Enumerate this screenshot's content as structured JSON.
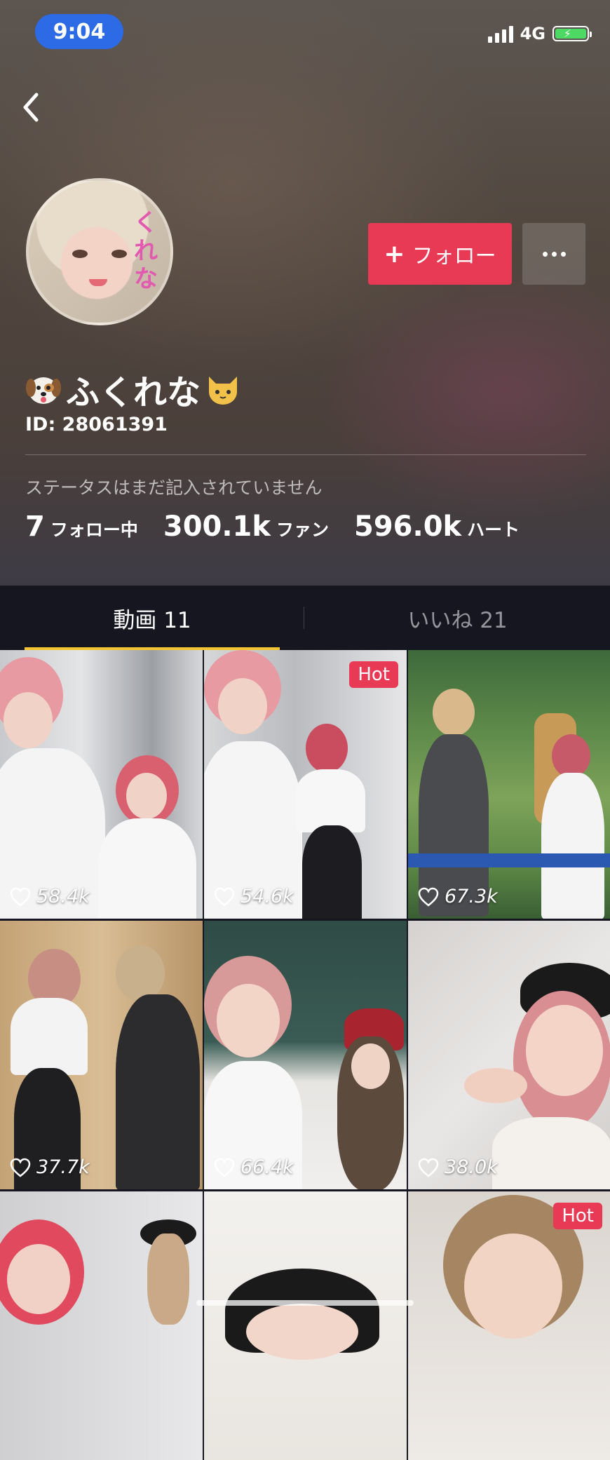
{
  "status_bar": {
    "time": "9:04",
    "network": "4G"
  },
  "profile": {
    "name": "ふくれな",
    "id_label": "ID: 28061391",
    "status": "ステータスはまだ記入されていません",
    "follow_label": "フォロー",
    "stats": [
      {
        "num": "7",
        "label": "フォロー中"
      },
      {
        "num": "300.1k",
        "label": "ファン"
      },
      {
        "num": "596.0k",
        "label": "ハート"
      }
    ]
  },
  "tabs": {
    "videos": "動画 11",
    "likes": "いいね 21"
  },
  "videos": [
    {
      "likes": "58.4k",
      "hot": ""
    },
    {
      "likes": "54.6k",
      "hot": "Hot"
    },
    {
      "likes": "67.3k",
      "hot": ""
    },
    {
      "likes": "37.7k",
      "hot": ""
    },
    {
      "likes": "66.4k",
      "hot": ""
    },
    {
      "likes": "38.0k",
      "hot": ""
    },
    {
      "likes": "",
      "hot": ""
    },
    {
      "likes": "",
      "hot": ""
    },
    {
      "likes": "",
      "hot": "Hot"
    }
  ],
  "colors": {
    "accent": "#e83a55",
    "tab_underline": "#f4c430",
    "time_pill": "#2c6ae6"
  },
  "icons": [
    "back-icon",
    "signal-icon",
    "battery-icon",
    "more-icon",
    "heart-icon",
    "dog-emoji-icon",
    "cat-emoji-icon"
  ]
}
